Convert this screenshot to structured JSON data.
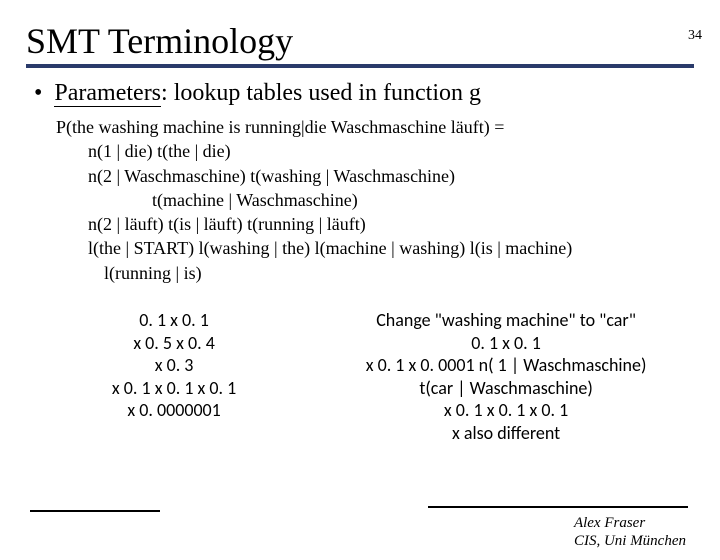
{
  "page_number": "34",
  "title": "SMT Terminology",
  "bullet": {
    "marker": "•",
    "label": "Parameters",
    "rest": ": lookup tables used in function g"
  },
  "equations": {
    "line1": "P(the washing machine is running|die Waschmaschine läuft) =",
    "line2": "n(1 | die) t(the | die)",
    "line3": "n(2 | Waschmaschine)  t(washing | Waschmaschine)",
    "line4": "t(machine | Waschmaschine)",
    "line5": "n(2 | läuft) t(is | läuft) t(running | läuft)",
    "line6": "l(the | START) l(washing | the) l(machine | washing) l(is | machine)",
    "line7": "l(running | is)"
  },
  "left_col": {
    "l1": "0. 1 x 0. 1",
    "l2": "x 0. 5 x 0. 4",
    "l3": "x 0. 3",
    "l4": "x 0. 1 x 0. 1 x 0. 1",
    "l5": "x 0. 0000001"
  },
  "right_col": {
    "r1": "Change \"washing machine\" to \"car\"",
    "r2": "0. 1 x 0. 1",
    "r3": "x 0. 1 x 0. 0001   n( 1 | Waschmaschine)",
    "r4": "t(car | Waschmaschine)",
    "r5": "x 0. 1 x 0. 1 x 0. 1",
    "r6": "x also different"
  },
  "footer": {
    "name": "Alex Fraser",
    "affil": "CIS, Uni München"
  }
}
